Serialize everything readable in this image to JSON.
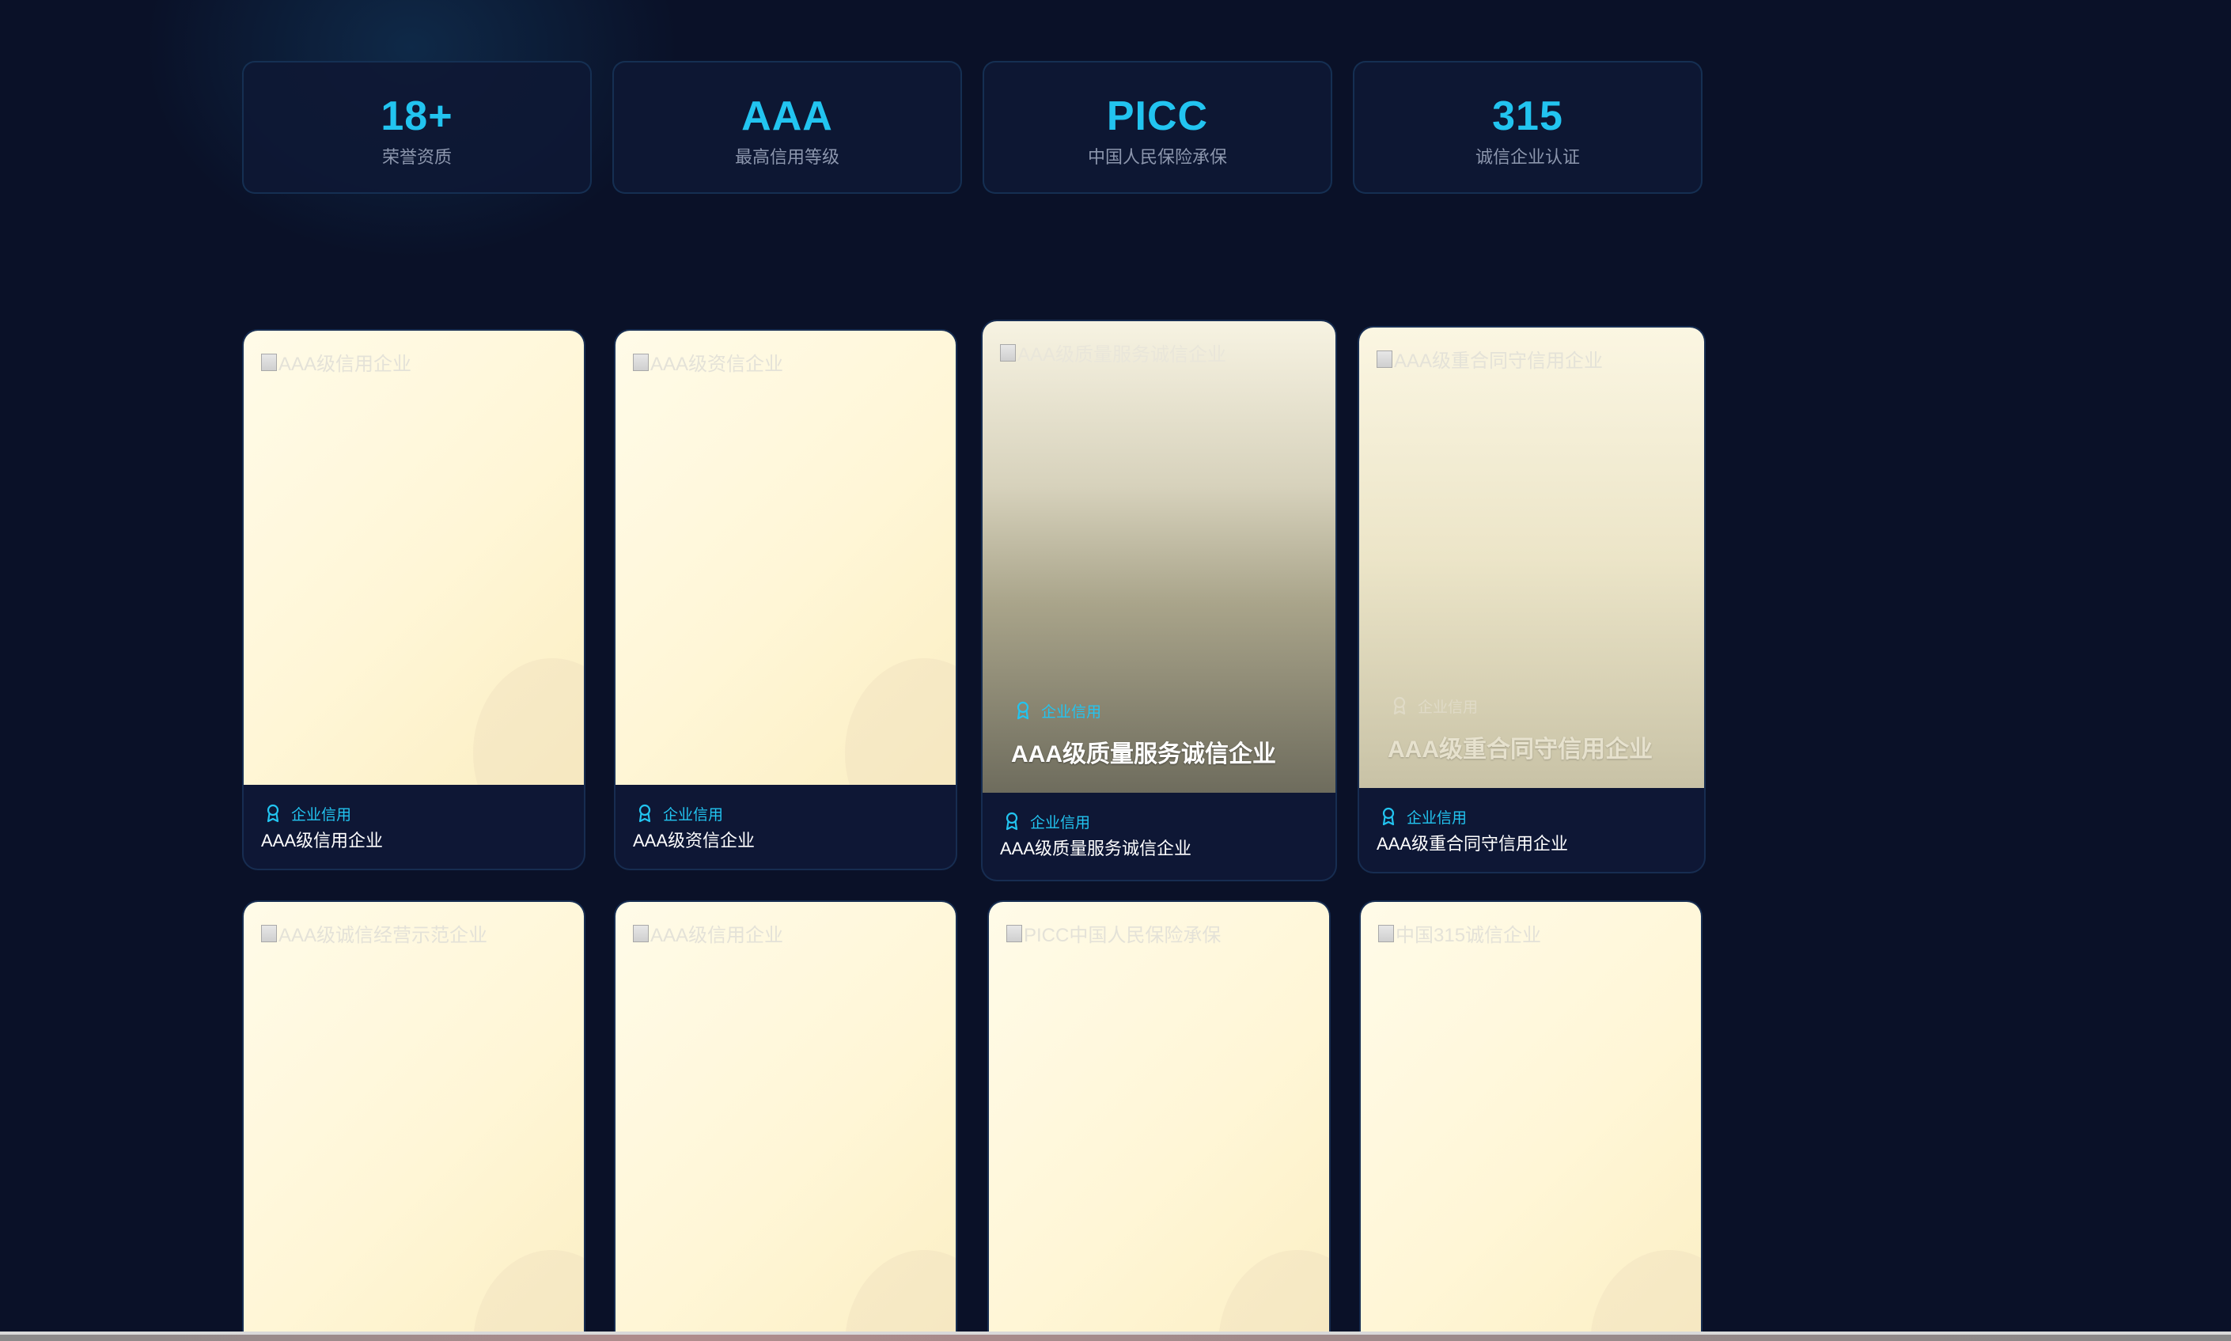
{
  "stats": [
    {
      "value": "18+",
      "label": "荣誉资质"
    },
    {
      "value": "AAA",
      "label": "最高信用等级"
    },
    {
      "value": "PICC",
      "label": "中国人民保险承保"
    },
    {
      "value": "315",
      "label": "诚信企业认证"
    }
  ],
  "honors": [
    {
      "alt": "AAA级信用企业",
      "tag": "企业信用",
      "title": "AAA级信用企业"
    },
    {
      "alt": "AAA级资信企业",
      "tag": "企业信用",
      "title": "AAA级资信企业"
    },
    {
      "alt": "AAA级质量服务诚信企业",
      "tag": "企业信用",
      "title": "AAA级质量服务诚信企业",
      "overlay_tag": "企业信用",
      "overlay_title": "AAA级质量服务诚信企业"
    },
    {
      "alt": "AAA级重合同守信用企业",
      "tag": "企业信用",
      "title": "AAA级重合同守信用企业",
      "overlay_tag": "企业信用",
      "overlay_title": "AAA级重合同守信用企业"
    },
    {
      "alt": "AAA级诚信经营示范企业"
    },
    {
      "alt": "AAA级信用企业"
    },
    {
      "alt": "PICC中国人民保险承保"
    },
    {
      "alt": "中国315诚信企业"
    }
  ],
  "colors": {
    "background": "#0a1128",
    "accent": "#22c4f0",
    "card": "#0e1735"
  },
  "icons": {
    "tag_icon": "award-ribbon-icon",
    "image_placeholder": "broken-image-icon"
  }
}
